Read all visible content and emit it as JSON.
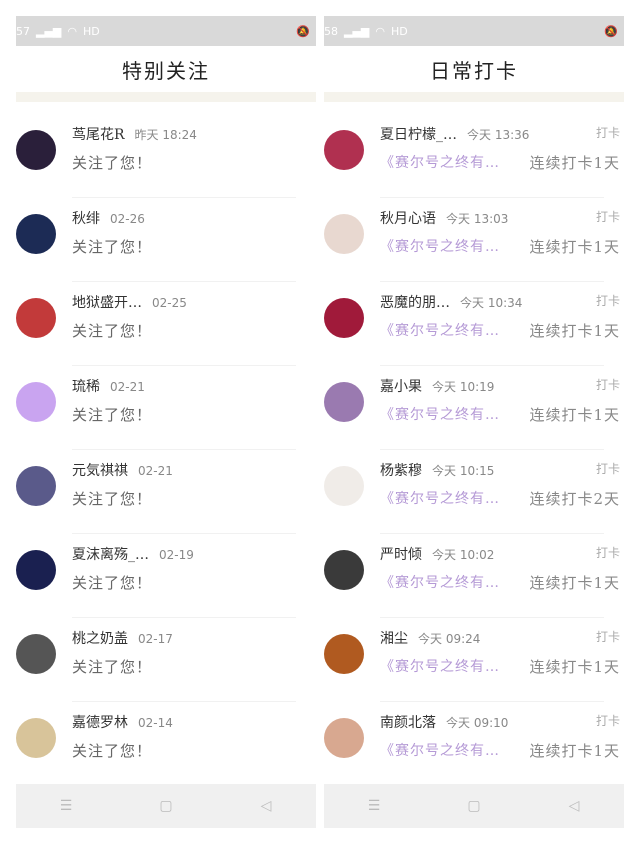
{
  "left": {
    "status": {
      "time": "57",
      "net": "HD"
    },
    "title": "特别关注",
    "items": [
      {
        "name": "茑尾花R",
        "time": "昨天 18:24",
        "msg": "关注了您！",
        "avatar_color": "#2a1f3a"
      },
      {
        "name": "秋绯",
        "time": "02-26",
        "msg": "关注了您！",
        "avatar_color": "#1c2b55"
      },
      {
        "name": "地狱盛开…",
        "time": "02-25",
        "msg": "关注了您！",
        "avatar_color": "#c23a3a"
      },
      {
        "name": "琉稀",
        "time": "02-21",
        "msg": "关注了您！",
        "avatar_color": "#c9a4f0"
      },
      {
        "name": "元気祺祺",
        "time": "02-21",
        "msg": "关注了您！",
        "avatar_color": "#5a5a8a"
      },
      {
        "name": "夏沫离殇_…",
        "time": "02-19",
        "msg": "关注了您！",
        "avatar_color": "#1a2050"
      },
      {
        "name": "桃之奶盖",
        "time": "02-17",
        "msg": "关注了您！",
        "avatar_color": "#555555"
      },
      {
        "name": "嘉德罗林",
        "time": "02-14",
        "msg": "关注了您！",
        "avatar_color": "#d8c49a"
      }
    ]
  },
  "right": {
    "status": {
      "time": "58",
      "net": "HD"
    },
    "title": "日常打卡",
    "items": [
      {
        "name": "夏日柠檬_…",
        "time": "今天 13:36",
        "tag": "打卡",
        "book": "《赛尔号之终有…",
        "streak": "连续打卡1天",
        "avatar_color": "#b03050"
      },
      {
        "name": "秋月心语",
        "time": "今天 13:03",
        "tag": "打卡",
        "book": "《赛尔号之终有…",
        "streak": "连续打卡1天",
        "avatar_color": "#e8d8d0"
      },
      {
        "name": "恶魔的朋…",
        "time": "今天 10:34",
        "tag": "打卡",
        "book": "《赛尔号之终有…",
        "streak": "连续打卡1天",
        "avatar_color": "#a01a3a"
      },
      {
        "name": "嘉小果",
        "time": "今天 10:19",
        "tag": "打卡",
        "book": "《赛尔号之终有…",
        "streak": "连续打卡1天",
        "avatar_color": "#9a7ab0"
      },
      {
        "name": "杨紫穆",
        "time": "今天 10:15",
        "tag": "打卡",
        "book": "《赛尔号之终有…",
        "streak": "连续打卡2天",
        "avatar_color": "#f0ece8"
      },
      {
        "name": "严时倾",
        "time": "今天 10:02",
        "tag": "打卡",
        "book": "《赛尔号之终有…",
        "streak": "连续打卡1天",
        "avatar_color": "#3a3a3a"
      },
      {
        "name": "湘尘",
        "time": "今天 09:24",
        "tag": "打卡",
        "book": "《赛尔号之终有…",
        "streak": "连续打卡1天",
        "avatar_color": "#b05a20"
      },
      {
        "name": "南颜北落",
        "time": "今天 09:10",
        "tag": "打卡",
        "book": "《赛尔号之终有…",
        "streak": "连续打卡1天",
        "avatar_color": "#d8a890"
      }
    ]
  },
  "nav": {
    "menu": "☰",
    "home": "▢",
    "back": "◁"
  }
}
